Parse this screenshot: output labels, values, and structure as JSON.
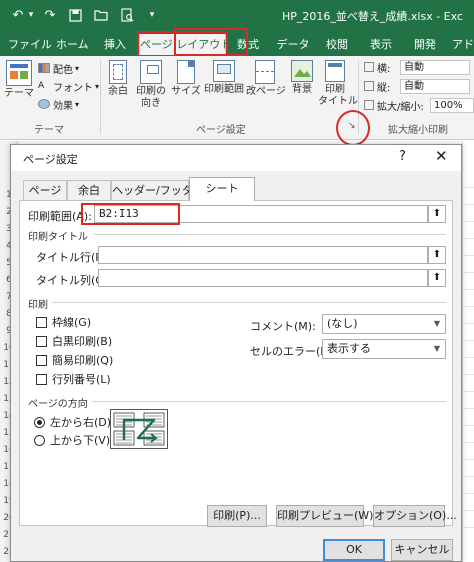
{
  "window": {
    "title": "HP_2016_並べ替え_成績.xlsx - Exc"
  },
  "qat": {
    "undo_glyph": "↶",
    "undo_dropdown_glyph": "▾",
    "save_glyph": "💾",
    "redo_glyph": "↷"
  },
  "ribbon_tabs": [
    {
      "label": "ファイル"
    },
    {
      "label": "ホーム"
    },
    {
      "label": "挿入"
    },
    {
      "label": "ページ レイアウト"
    },
    {
      "label": "数式"
    },
    {
      "label": "データ"
    },
    {
      "label": "校閲"
    },
    {
      "label": "表示"
    },
    {
      "label": "開発"
    },
    {
      "label": "アド"
    }
  ],
  "ribbon": {
    "theme_group": {
      "themes": "テーマ",
      "colors": "配色",
      "fonts": "フォント",
      "effects": "効果",
      "group_label": "テーマ"
    },
    "page_setup_group": {
      "margins": "余白",
      "orientation_line1": "印刷の",
      "orientation_line2": "向き",
      "size": "サイズ",
      "print_area": "印刷範囲",
      "breaks": "改ページ",
      "background": "背景",
      "titles_line1": "印刷",
      "titles_line2": "タイトル",
      "group_label": "ページ設定",
      "launcher_glyph": "↘"
    },
    "scale_group": {
      "width_label": "横:",
      "width_value": "自動",
      "height_label": "縦:",
      "height_value": "自動",
      "scale_label": "拡大/縮小:",
      "scale_value": "100%",
      "group_label": "拡大縮小印刷"
    }
  },
  "sheet": {
    "row_numbers": [
      "1",
      "2",
      "3",
      "4",
      "5",
      "6",
      "7",
      "8",
      "9",
      "10",
      "11",
      "12",
      "13",
      "14",
      "15",
      "16",
      "17",
      "18",
      "19",
      "20",
      "21",
      "22",
      "23",
      "24",
      "25"
    ]
  },
  "dialog": {
    "title": "ページ設定",
    "help_glyph": "?",
    "close_glyph": "✕",
    "tabs": [
      "ページ",
      "余白",
      "ヘッダー/フッター",
      "シート"
    ],
    "print_area_label": "印刷範囲(A):",
    "print_area_value": "B2:I13",
    "collapse_glyph": "⬆",
    "print_titles_section": "印刷タイトル",
    "title_rows_label": "タイトル行(R):",
    "title_rows_value": "",
    "title_cols_label": "タイトル列(C):",
    "title_cols_value": "",
    "print_section": "印刷",
    "options": [
      {
        "label": "枠線(G)",
        "checked": false
      },
      {
        "label": "白黒印刷(B)",
        "checked": false
      },
      {
        "label": "簡易印刷(Q)",
        "checked": false
      },
      {
        "label": "行列番号(L)",
        "checked": false
      }
    ],
    "comments_label": "コメント(M):",
    "comments_value": "(なし)",
    "errors_label": "セルのエラー(E):",
    "errors_value": "表示する",
    "dropdown_glyph": "▼",
    "page_order_section": "ページの方向",
    "page_order": [
      {
        "label": "左から右(D)",
        "checked": true
      },
      {
        "label": "上から下(V)",
        "checked": false
      }
    ],
    "buttons": {
      "print": "印刷(P)...",
      "print_preview": "印刷プレビュー(W)",
      "options": "オプション(O)...",
      "ok": "OK",
      "cancel": "キャンセル"
    }
  },
  "colors": {
    "excel_green": "#217346",
    "annotation_red": "#d92a2a"
  }
}
